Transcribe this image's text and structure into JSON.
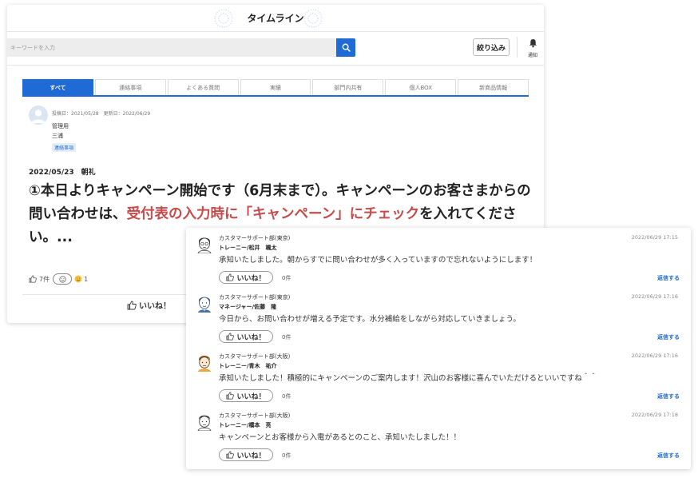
{
  "header": {
    "title": "タイムライン"
  },
  "search": {
    "placeholder": "キーワードを入力",
    "filter_label": "絞り込み",
    "notify_label": "通知"
  },
  "tabs": [
    {
      "label": "すべて",
      "active": true
    },
    {
      "label": "連絡事項"
    },
    {
      "label": "よくある質問"
    },
    {
      "label": "実績"
    },
    {
      "label": "部門内共有"
    },
    {
      "label": "個人BOX"
    },
    {
      "label": "新商品情報"
    }
  ],
  "post": {
    "meta": "投稿日：2021/05/28　更新日：2022/06/29",
    "role": "管理用",
    "author": "三浦",
    "tag": "連絡事項",
    "date_title": "2022/05/23　朝礼",
    "body_part1": "①本日よりキャンペーン開始です（6月末まで）。キャンペーンのお客さまからの問い合わせは、",
    "body_highlight": "受付表の入力時に「キャンペーン」にチェック",
    "body_part2": "を入れてください。...",
    "like_count": "7件",
    "reaction_count": "1",
    "like_label": "いいね！"
  },
  "comments": [
    {
      "dept": "カスタマーサポート部(東京)",
      "name": "トレーニー/松井　颯太",
      "time": "2022/06/29 17:15",
      "text": "承知いたしました。朝からすでに問い合わせが多く入っていますので忘れないようにします！",
      "like_label": "いいね！",
      "count": "0件",
      "reply_label": "返信する"
    },
    {
      "dept": "カスタマーサポート部(東京)",
      "name": "マネージャー/佐藤　隆",
      "time": "2022/06/29 17:16",
      "text": "今日から、お問い合わせが増える予定です。水分補給をしながら対応していきましょう。",
      "like_label": "いいね！",
      "count": "0件",
      "reply_label": "返信する"
    },
    {
      "dept": "カスタマーサポート部(大阪)",
      "name": "トレーニー/青木　祐介",
      "time": "2022/06/29 17:16",
      "text": "承知いたしました！積極的にキャンペーンのご案内します！沢山のお客様に喜んでいただけるといいですね＾＾",
      "like_label": "いいね！",
      "count": "0件",
      "reply_label": "返信する"
    },
    {
      "dept": "カスタマーサポート部(大阪)",
      "name": "トレーニー/橋本　亮",
      "time": "2022/06/29 17:18",
      "text": "キャンペーンとお客様から入電があるとのこと、承知いたしました！！",
      "like_label": "いいね！",
      "count": "0件",
      "reply_label": "返信する"
    }
  ],
  "colors": {
    "accent": "#1e6bd6",
    "highlight": "#c74b4b"
  }
}
